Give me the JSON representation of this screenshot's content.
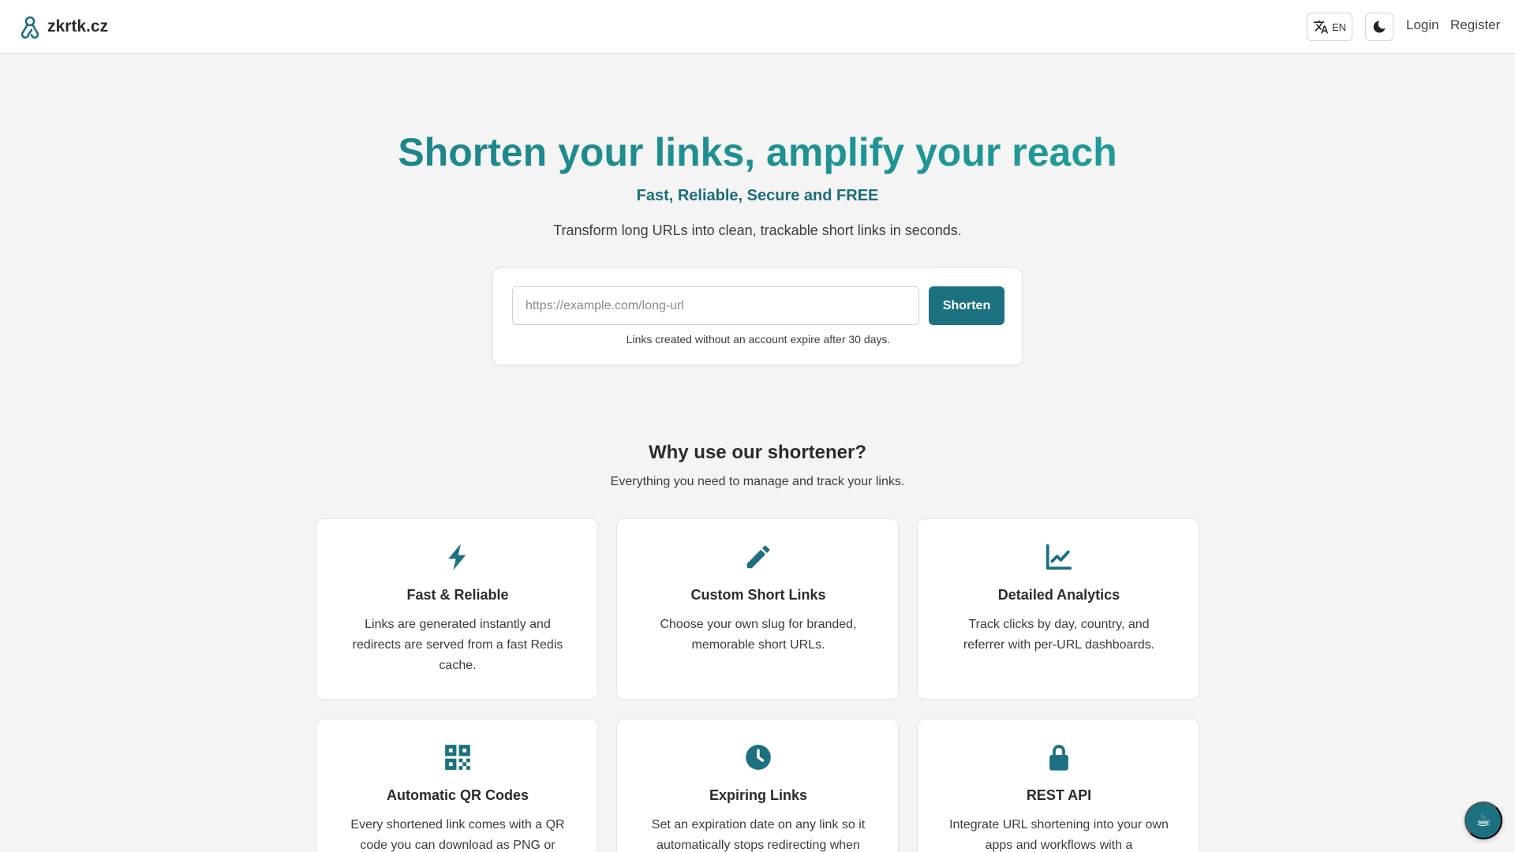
{
  "header": {
    "brand": "zkrtk.cz",
    "language": "EN",
    "login": "Login",
    "register": "Register"
  },
  "icons": {
    "brand": "logo-icon",
    "language": "translate-icon",
    "theme": "moon-icon",
    "coffee": "coffee-icon"
  },
  "hero": {
    "title": "Shorten your links, amplify your reach",
    "subtitle": "Fast, Reliable, Secure and FREE",
    "description": "Transform long URLs into clean, trackable short links in seconds."
  },
  "shortener": {
    "placeholder": "https://example.com/long-url",
    "value": "",
    "button": "Shorten",
    "note": "Links created without an account expire after 30 days."
  },
  "why": {
    "title": "Why use our shortener?",
    "subtitle": "Everything you need to manage and track your links."
  },
  "features": [
    {
      "icon": "bolt-icon",
      "title": "Fast & Reliable",
      "description": "Links are generated instantly and redirects are served from a fast Redis cache."
    },
    {
      "icon": "pencil-icon",
      "title": "Custom Short Links",
      "description": "Choose your own slug for branded, memorable short URLs."
    },
    {
      "icon": "chart-line-icon",
      "title": "Detailed Analytics",
      "description": "Track clicks by day, country, and referrer with per-URL dashboards."
    },
    {
      "icon": "qr-code-icon",
      "title": "Automatic QR Codes",
      "description": "Every shortened link comes with a QR code you can download as PNG or SVG"
    },
    {
      "icon": "clock-icon",
      "title": "Expiring Links",
      "description": "Set an expiration date on any link so it automatically stops redirecting when you"
    },
    {
      "icon": "lock-icon",
      "title": "REST API",
      "description": "Integrate URL shortening into your own apps and workflows with a documented"
    }
  ],
  "colors": {
    "accent": "#1b7180",
    "gradient_start": "#1c7a82",
    "gradient_end": "#22a6a0",
    "background": "#f4f4f4"
  }
}
